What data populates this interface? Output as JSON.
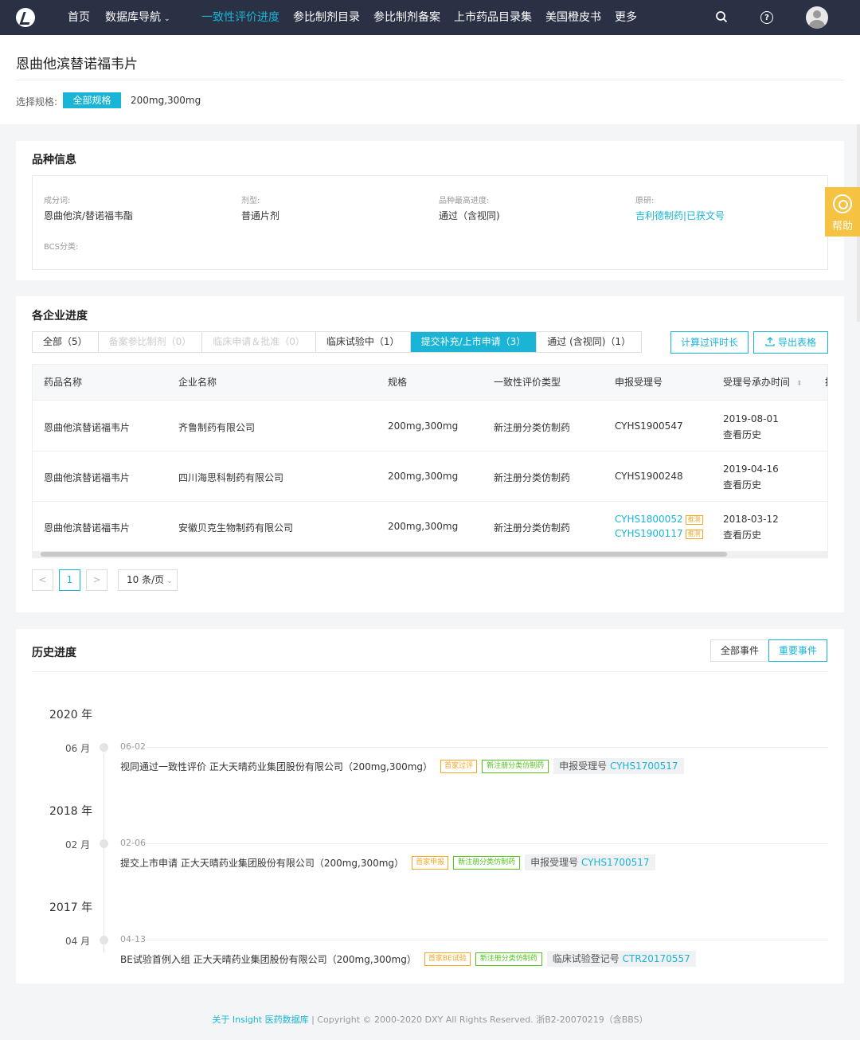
{
  "nav": {
    "items": [
      {
        "label": "首页"
      },
      {
        "label": "数据库导航",
        "dropdown": true
      },
      {
        "label": "一致性评价进度",
        "active": true
      },
      {
        "label": "参比制剂目录"
      },
      {
        "label": "参比制剂备案"
      },
      {
        "label": "上市药品目录集"
      },
      {
        "label": "美国橙皮书"
      },
      {
        "label": "更多"
      }
    ],
    "icons": [
      "search-icon",
      "help-icon",
      "user-avatar"
    ]
  },
  "page": {
    "title": "恩曲他滨替诺福韦片",
    "spec_label": "选择规格:",
    "spec_all": "全部规格",
    "spec_option": "200mg,300mg"
  },
  "info": {
    "title": "品种信息",
    "fields": {
      "ingredient_label": "成分词:",
      "ingredient_value": "恩曲他滨/替诺福韦酯",
      "form_label": "剂型:",
      "form_value": "普通片剂",
      "progress_label": "品种最高进度:",
      "progress_value": "通过（含视同)",
      "origin_label": "原研:",
      "origin_value": "吉利德制药|已获文号",
      "bcs_label": "BCS分类:"
    }
  },
  "progress": {
    "title": "各企业进度",
    "tabs": [
      {
        "label": "全部（5）",
        "state": "normal"
      },
      {
        "label": "备案参比制剂（0）",
        "state": "disabled"
      },
      {
        "label": "临床申请＆批准（0）",
        "state": "disabled"
      },
      {
        "label": "临床试验中（1）",
        "state": "normal"
      },
      {
        "label": "提交补充/上市申请（3）",
        "state": "active"
      },
      {
        "label": "通过 (含视同)（1）",
        "state": "normal"
      }
    ],
    "calc_button": "计算过评时长",
    "export_button": "导出表格",
    "columns": [
      "药品名称",
      "企业名称",
      "规格",
      "一致性评价类型",
      "申报受理号",
      "受理号承办时间",
      "挂"
    ],
    "rows": [
      {
        "drug": "恩曲他滨替诺福韦片",
        "company": "齐鲁制药有限公司",
        "spec": "200mg,300mg",
        "type": "新注册分类仿制药",
        "nos": [
          {
            "no": "CYHS1900547",
            "tag": ""
          }
        ],
        "date": "2019-08-01",
        "history": "查看历史"
      },
      {
        "drug": "恩曲他滨替诺福韦片",
        "company": "四川海思科制药有限公司",
        "spec": "200mg,300mg",
        "type": "新注册分类仿制药",
        "nos": [
          {
            "no": "CYHS1900248",
            "tag": ""
          }
        ],
        "date": "2019-04-16",
        "history": "查看历史"
      },
      {
        "drug": "恩曲他滨替诺福韦片",
        "company": "安徽贝克生物制药有限公司",
        "spec": "200mg,300mg",
        "type": "新注册分类仿制药",
        "nos": [
          {
            "no": "CYHS1800052",
            "tag": "推测"
          },
          {
            "no": "CYHS1900117",
            "tag": "推测"
          }
        ],
        "date": "2018-03-12",
        "history": "查看历史"
      }
    ],
    "pagination": {
      "prev": "<",
      "current": "1",
      "next": ">",
      "page_size": "10 条/页"
    }
  },
  "history": {
    "title": "历史进度",
    "filter_all": "全部事件",
    "filter_important": "重要事件",
    "years": [
      {
        "year": "2020 年",
        "month": "06 月",
        "date": "06-02",
        "text": "视同通过一致性评价 正大天晴药业集团股份有限公司（200mg,300mg）",
        "badge1": "首家过评",
        "badge2": "新注册分类仿制药",
        "ref_label": "申报受理号",
        "ref_no": "CYHS1700517"
      },
      {
        "year": "2018 年",
        "month": "02 月",
        "date": "02-06",
        "text": "提交上市申请 正大天晴药业集团股份有限公司（200mg,300mg）",
        "badge1": "首家申报",
        "badge2": "新注册分类仿制药",
        "ref_label": "申报受理号",
        "ref_no": "CYHS1700517"
      },
      {
        "year": "2017 年",
        "month": "04 月",
        "date": "04-13",
        "text": "BE试验首例入组 正大天晴药业集团股份有限公司（200mg,300mg）",
        "badge1": "首家BE试验",
        "badge2": "新注册分类仿制药",
        "ref_label": "临床试验登记号",
        "ref_no": "CTR20170557"
      }
    ]
  },
  "footer": {
    "link": "关于 Insight 医药数据库",
    "text": " | Copyright © 2000-2020 DXY All Rights Reserved. 浙B2-20070219（含BBS）"
  },
  "help_widget": {
    "label": "帮助"
  },
  "colors": {
    "accent": "#19b4d6",
    "nav_bg": "#2b3144",
    "warning": "#f5a623",
    "success": "#52c41a"
  }
}
